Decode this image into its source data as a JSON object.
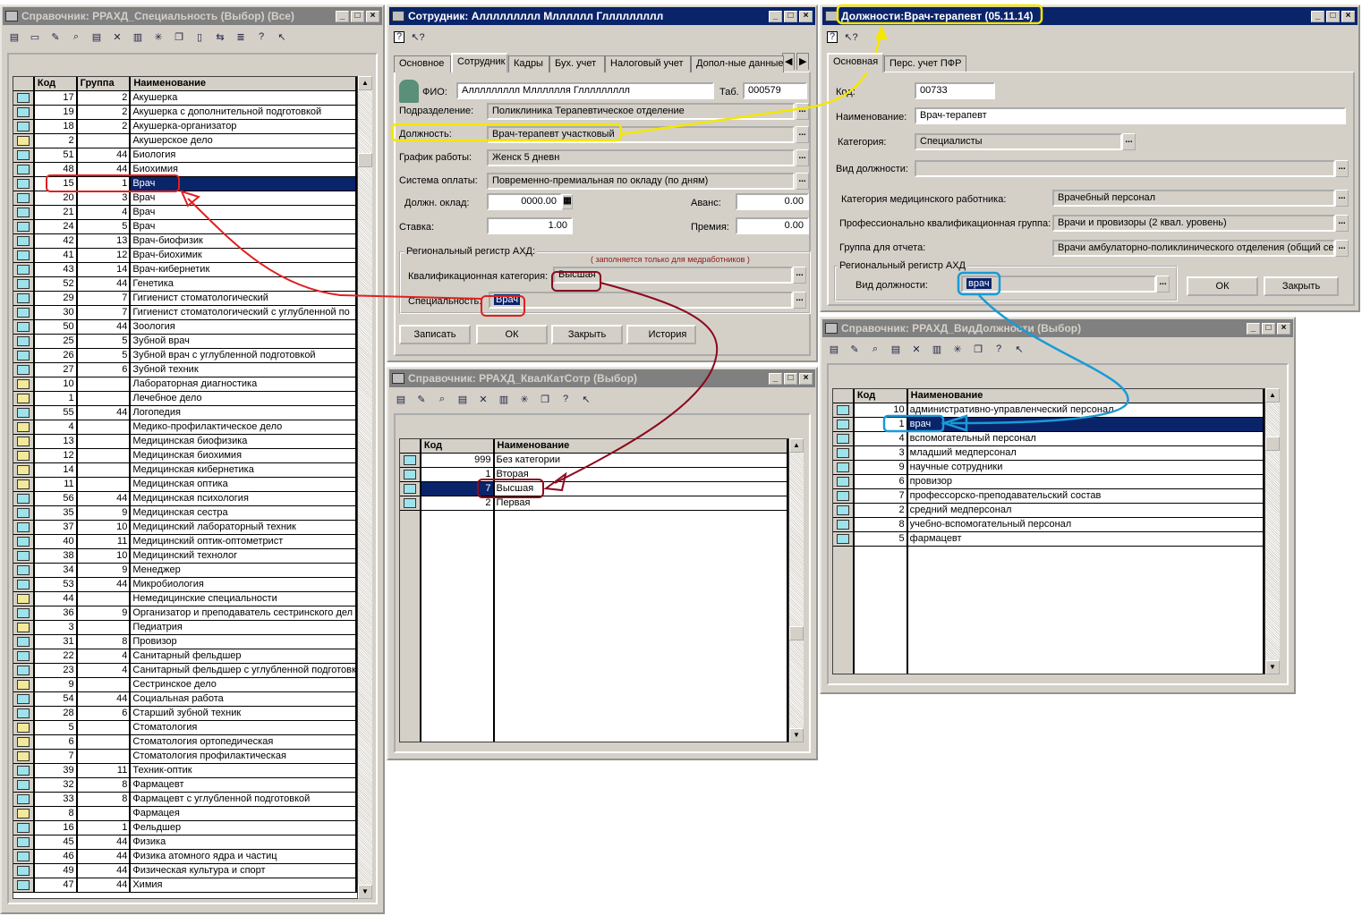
{
  "spec_window": {
    "title": "Справочник: РРАХД_Специальность (Выбор) (Все)",
    "columns": [
      "Код",
      "Группа",
      "Наименование"
    ],
    "selected_index": 6,
    "rows": [
      [
        "17",
        "2",
        "Акушерка"
      ],
      [
        "19",
        "2",
        "Акушерка с дополнительной подготовкой"
      ],
      [
        "18",
        "2",
        "Акушерка-организатор"
      ],
      [
        "2",
        "",
        "Акушерское дело"
      ],
      [
        "51",
        "44",
        "Биология"
      ],
      [
        "48",
        "44",
        "Биохимия"
      ],
      [
        "15",
        "1",
        "Врач"
      ],
      [
        "20",
        "3",
        "Врач"
      ],
      [
        "21",
        "4",
        "Врач"
      ],
      [
        "24",
        "5",
        "Врач"
      ],
      [
        "42",
        "13",
        "Врач-биофизик"
      ],
      [
        "41",
        "12",
        "Врач-биохимик"
      ],
      [
        "43",
        "14",
        "Врач-кибернетик"
      ],
      [
        "52",
        "44",
        "Генетика"
      ],
      [
        "29",
        "7",
        "Гигиенист стоматологический"
      ],
      [
        "30",
        "7",
        "Гигиенист стоматологический с углубленной по"
      ],
      [
        "50",
        "44",
        "Зоология"
      ],
      [
        "25",
        "5",
        "Зубной врач"
      ],
      [
        "26",
        "5",
        "Зубной врач с углубленной подготовкой"
      ],
      [
        "27",
        "6",
        "Зубной техник"
      ],
      [
        "10",
        "",
        "Лабораторная диагностика"
      ],
      [
        "1",
        "",
        "Лечебное дело"
      ],
      [
        "55",
        "44",
        "Логопедия"
      ],
      [
        "4",
        "",
        "Медико-профилактическое дело"
      ],
      [
        "13",
        "",
        "Медицинская биофизика"
      ],
      [
        "12",
        "",
        "Медицинская биохимия"
      ],
      [
        "14",
        "",
        "Медицинская кибернетика"
      ],
      [
        "11",
        "",
        "Медицинская оптика"
      ],
      [
        "56",
        "44",
        "Медицинская психология"
      ],
      [
        "35",
        "9",
        "Медицинская сестра"
      ],
      [
        "37",
        "10",
        "Медицинский лабораторный техник"
      ],
      [
        "40",
        "11",
        "Медицинский оптик-оптометрист"
      ],
      [
        "38",
        "10",
        "Медицинский технолог"
      ],
      [
        "34",
        "9",
        "Менеджер"
      ],
      [
        "53",
        "44",
        "Микробиология"
      ],
      [
        "44",
        "",
        "Немедицинские специальности"
      ],
      [
        "36",
        "9",
        "Организатор и преподаватель сестринского дел"
      ],
      [
        "3",
        "",
        "Педиатрия"
      ],
      [
        "31",
        "8",
        "Провизор"
      ],
      [
        "22",
        "4",
        "Санитарный фельдшер"
      ],
      [
        "23",
        "4",
        "Санитарный фельдшер с углубленной подготовк"
      ],
      [
        "9",
        "",
        "Сестринское дело"
      ],
      [
        "54",
        "44",
        "Социальная работа"
      ],
      [
        "28",
        "6",
        "Старший зубной техник"
      ],
      [
        "5",
        "",
        "Стоматология"
      ],
      [
        "6",
        "",
        "Стоматология ортопедическая"
      ],
      [
        "7",
        "",
        "Стоматология профилактическая"
      ],
      [
        "39",
        "11",
        "Техник-оптик"
      ],
      [
        "32",
        "8",
        "Фармацевт"
      ],
      [
        "33",
        "8",
        "Фармацевт с углубленной подготовкой"
      ],
      [
        "8",
        "",
        "Фармацея"
      ],
      [
        "16",
        "1",
        "Фельдшер"
      ],
      [
        "45",
        "44",
        "Физика"
      ],
      [
        "46",
        "44",
        "Физика атомного ядра и частиц"
      ],
      [
        "49",
        "44",
        "Физическая культура и спорт"
      ],
      [
        "47",
        "44",
        "Химия"
      ]
    ]
  },
  "employee_window": {
    "title": "Сотрудник: Аллллллллл Млллллл Гллллллллл",
    "tabs": [
      "Основное",
      "Сотрудник",
      "Кадры",
      "Бух. учет",
      "Налоговый учет",
      "Допол-ные данные"
    ],
    "fio_label": "ФИО:",
    "fio": "Аллллллллл Млллллля Гллллллллл",
    "tab_label": "Таб.",
    "tab_no": "000579",
    "dept_label": "Подразделение:",
    "dept": "Поликлиника      Терапевтическое отделение",
    "position_label": "Должность:",
    "position": "Врач-терапевт участковый",
    "schedule_label": "График работы:",
    "schedule": "Женск 5 дневн",
    "pay_label": "Система оплаты:",
    "pay": "Повременно-премиальная по окладу (по дням)",
    "salary_label": "Должн. оклад:",
    "salary": "0000.00",
    "rate_label": "Ставка:",
    "rate": "1.00",
    "advance_label": "Аванс:",
    "advance": "0.00",
    "bonus_label": "Премия:",
    "bonus": "0.00",
    "group_label": "Региональный регистр АХД:",
    "note": "( заполняется только для медработников )",
    "qual_label": "Квалификационная категория:",
    "qual": "Высшая",
    "spec_label": "Специальность:",
    "spec": "Врач",
    "buttons": [
      "Записать",
      "ОК",
      "Закрыть",
      "История"
    ]
  },
  "qual_window": {
    "title": "Справочник: РРАХД_КвалКатСотр (Выбор)",
    "columns": [
      "Код",
      "Наименование"
    ],
    "selected_index": 2,
    "rows": [
      [
        "999",
        "Без категории"
      ],
      [
        "1",
        "Вторая"
      ],
      [
        "7",
        "Высшая"
      ],
      [
        "2",
        "Первая"
      ]
    ]
  },
  "position_window": {
    "title": "Должности:Врач-терапевт (05.11.14)",
    "tabs": [
      "Основная",
      "Перс. учет ПФР"
    ],
    "code_label": "Код:",
    "code": "00733",
    "name_label": "Наименование:",
    "name": "Врач-терапевт",
    "cat_label": "Категория:",
    "cat": "Специалисты",
    "kind_label": "Вид должности:",
    "kind": "",
    "medcat_label": "Категория медицинского работника:",
    "medcat": "Врачебный персонал",
    "pkg_label": "Профессионально квалификационная группа:",
    "pkg": "Врачи и провизоры (2 квал. уровень)",
    "report_label": "Группа для отчета:",
    "report": "Врачи амбулаторно-поликлинического отделения (общий се",
    "group_label": "Региональный регистр АХД",
    "reg_kind_label": "Вид должности:",
    "reg_kind": "врач",
    "ok": "ОК",
    "close": "Закрыть"
  },
  "kind_window": {
    "title": "Справочник: РРАХД_ВидДолжности (Выбор)",
    "columns": [
      "Код",
      "Наименование"
    ],
    "selected_index": 1,
    "rows": [
      [
        "10",
        "административно-управленческий персонал"
      ],
      [
        "1",
        "врач"
      ],
      [
        "4",
        "вспомогательный персонал"
      ],
      [
        "3",
        "младший медперсонал"
      ],
      [
        "9",
        "научные сотрудники"
      ],
      [
        "6",
        "провизор"
      ],
      [
        "7",
        "профессорско-преподавательский состав"
      ],
      [
        "2",
        "средний медперсонал"
      ],
      [
        "8",
        "учебно-вспомогательный персонал"
      ],
      [
        "5",
        "фармацевт"
      ]
    ]
  },
  "annotation_colors": {
    "yellow": "#f5e600",
    "red": "#e02020",
    "darkred": "#8b0a1e",
    "blue": "#1a9ad6"
  }
}
